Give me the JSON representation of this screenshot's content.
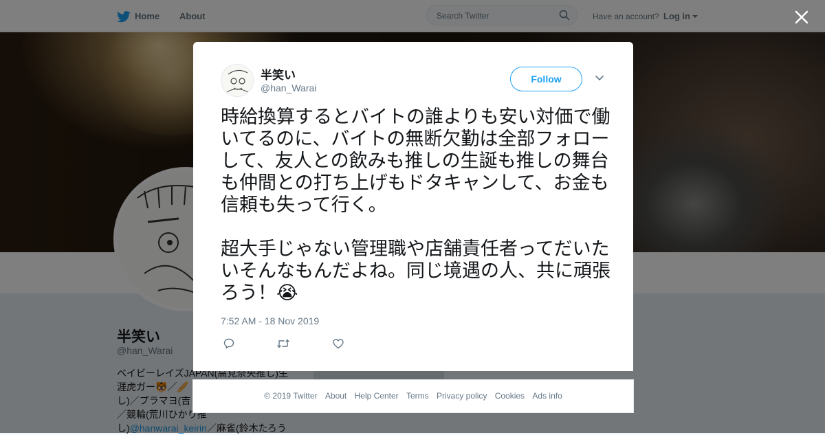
{
  "topbar": {
    "home_label": "Home",
    "about_label": "About",
    "search_placeholder": "Search Twitter",
    "have_account": "Have an account?",
    "login_label": "Log in"
  },
  "profile": {
    "name": "半笑い",
    "handle": "@han_Warai",
    "bio_lines": [
      "ベイビーレイズJAPAN(高見奈央推し)生",
      "涯虎ガー🐯／🥖",
      "し)／プラマヨ(吉",
      "／競輪(荒川ひかり推",
      "し)"
    ],
    "bio_link": "@hanwarai_keirin",
    "bio_tail": "／麻雀(鈴木たろう"
  },
  "tweet": {
    "author_name": "半笑い",
    "author_handle": "@han_Warai",
    "follow_label": "Follow",
    "text": "時給換算するとバイトの誰よりも安い対価で働いてるのに、バイトの無断欠勤は全部フォローして、友人との飲みも推しの生誕も推しの舞台も仲間との打ち上げもドタキャンして、お金も信頼も失って行く。\n\n超大手じゃない管理職や店舗責任者ってだいたいそんなもんだよね。同じ境遇の人、共に頑張ろう！😭",
    "timestamp": "7:52 AM - 18 Nov 2019"
  },
  "footer": {
    "copyright": "© 2019 Twitter",
    "links": [
      "About",
      "Help Center",
      "Terms",
      "Privacy policy",
      "Cookies",
      "Ads info"
    ]
  },
  "colors": {
    "accent": "#1da1f2",
    "text": "#14171a",
    "muted": "#657786",
    "overlay": "rgba(0,0,0,0.5)"
  },
  "icons": [
    "twitter-bird-icon",
    "search-icon",
    "caret-down-icon",
    "close-icon",
    "reply-icon",
    "retweet-icon",
    "heart-icon"
  ]
}
